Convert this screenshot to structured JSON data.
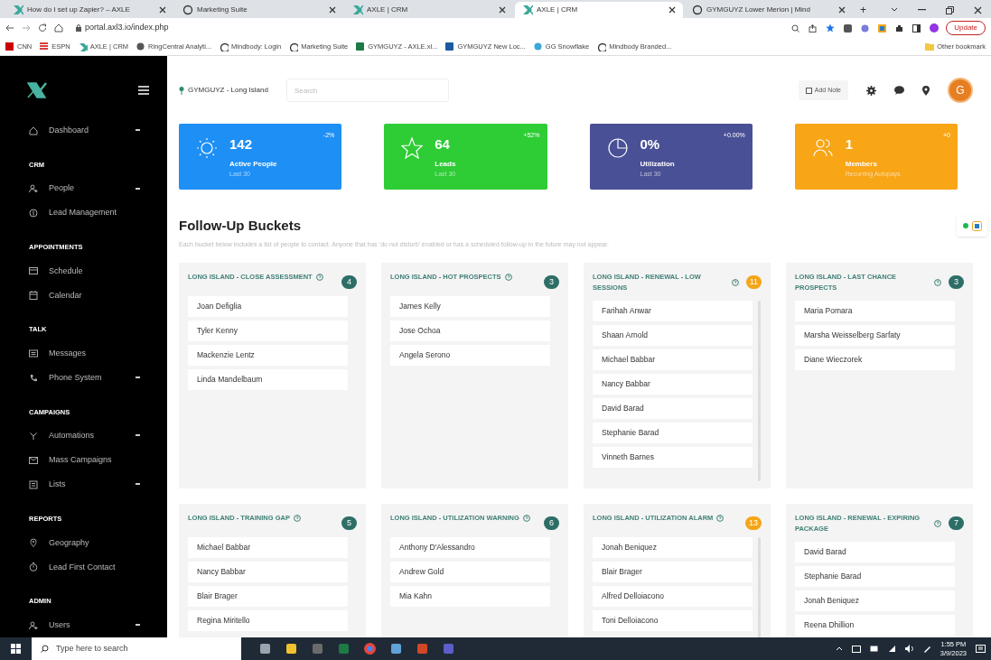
{
  "browser": {
    "tabs": [
      {
        "title": "How do I set up Zapier? – AXLE",
        "selected": false
      },
      {
        "title": "Marketing Suite",
        "selected": false
      },
      {
        "title": "AXLE | CRM",
        "selected": false
      },
      {
        "title": "AXLE | CRM",
        "selected": true
      },
      {
        "title": "GYMGUYZ Lower Merion | Mind",
        "selected": false
      }
    ],
    "new_tab": "+",
    "address": "portal.axl3.io/index.php",
    "update_button": "Update",
    "bookmarks": [
      "CNN",
      "ESPN",
      "AXLE | CRM",
      "RingCentral Analyti...",
      "Mindbody: Login",
      "Marketing Suite",
      "GYMGUYZ - AXLE.xl...",
      "GYMGUYZ New Loc...",
      "GG Snowflake",
      "Mindbody Branded..."
    ],
    "other_bookmarks": "Other bookmark"
  },
  "sidebar": {
    "sections": [
      {
        "items": [
          {
            "label": "Dashboard",
            "submenu": true
          }
        ]
      },
      {
        "heading": "CRM",
        "items": [
          {
            "label": "People",
            "submenu": true
          },
          {
            "label": "Lead Management",
            "submenu": false
          }
        ]
      },
      {
        "heading": "APPOINTMENTS",
        "items": [
          {
            "label": "Schedule",
            "submenu": false
          },
          {
            "label": "Calendar",
            "submenu": false
          }
        ]
      },
      {
        "heading": "TALK",
        "items": [
          {
            "label": "Messages",
            "submenu": false
          },
          {
            "label": "Phone System",
            "submenu": true
          }
        ]
      },
      {
        "heading": "CAMPAIGNS",
        "items": [
          {
            "label": "Automations",
            "submenu": true
          },
          {
            "label": "Mass Campaigns",
            "submenu": false
          },
          {
            "label": "Lists",
            "submenu": true
          }
        ]
      },
      {
        "heading": "REPORTS",
        "items": [
          {
            "label": "Geography",
            "submenu": false
          },
          {
            "label": "Lead First Contact",
            "submenu": false
          }
        ]
      },
      {
        "heading": "ADMIN",
        "items": [
          {
            "label": "Users",
            "submenu": true
          }
        ]
      }
    ]
  },
  "topbar": {
    "location": "GYMGUYZ - Long Island",
    "search_placeholder": "Search",
    "add_note": "Add Note",
    "avatar": "G"
  },
  "stats": [
    {
      "value": "142",
      "label": "Active People",
      "sub": "Last 30",
      "change": "-2%",
      "color": "#1e8ff5"
    },
    {
      "value": "64",
      "label": "Leads",
      "sub": "Last 30",
      "change": "+52%",
      "color": "#2ecc35"
    },
    {
      "value": "0%",
      "label": "Utilization",
      "sub": "Last 30",
      "change": "+0.00%",
      "color": "#4a5096"
    },
    {
      "value": "1",
      "label": "Members",
      "sub": "Recurring Autopays",
      "change": "+0",
      "color": "#f8a516"
    }
  ],
  "buckets_section": {
    "title": "Follow-Up Buckets",
    "description": "Each bucket below includes a list of people to contact. Anyone that has 'do not disturb' enabled or has a scheduled follow-up in the future may not appear."
  },
  "buckets": [
    {
      "title": "LONG ISLAND - CLOSE ASSESSMENT",
      "count": "4",
      "color": "#2d6e67",
      "scrollable": false,
      "people": [
        "Joan Defiglia",
        "Tyler Kenny",
        "Mackenzie Lentz",
        "Linda Mandelbaum"
      ]
    },
    {
      "title": "LONG ISLAND - HOT PROSPECTS",
      "count": "3",
      "color": "#2d6e67",
      "scrollable": false,
      "people": [
        "James Kelly",
        "Jose Ochoa",
        "Angela Serono"
      ]
    },
    {
      "title": "LONG ISLAND - RENEWAL - LOW SESSIONS",
      "count": "11",
      "color": "#f5a516",
      "scrollable": true,
      "people": [
        "Farihah Anwar",
        "Shaan Arnold",
        "Michael Babbar",
        "Nancy Babbar",
        "David Barad",
        "Stephanie Barad",
        "Vinneth Barnes"
      ]
    },
    {
      "title": "LONG ISLAND - LAST CHANCE PROSPECTS",
      "count": "3",
      "color": "#2d6e67",
      "scrollable": false,
      "people": [
        "Maria Pomara",
        "Marsha Weisselberg Sarfaty",
        "Diane Wieczorek"
      ]
    },
    {
      "title": "LONG ISLAND - TRAINING GAP",
      "count": "5",
      "color": "#2d6e67",
      "scrollable": false,
      "people": [
        "Michael Babbar",
        "Nancy Babbar",
        "Blair Brager",
        "Regina Miritello"
      ]
    },
    {
      "title": "LONG ISLAND - UTILIZATION WARNING",
      "count": "6",
      "color": "#2d6e67",
      "scrollable": false,
      "people": [
        "Anthony D'Alessandro",
        "Andrew Gold",
        "Mia Kahn"
      ]
    },
    {
      "title": "LONG ISLAND - UTILIZATION ALARM",
      "count": "13",
      "color": "#f5a516",
      "scrollable": true,
      "people": [
        "Jonah Beniquez",
        "Blair Brager",
        "Alfred Delloiacono",
        "Toni Delloiacono"
      ]
    },
    {
      "title": "LONG ISLAND - RENEWAL - EXPIRING PACKAGE",
      "count": "7",
      "color": "#2d6e67",
      "scrollable": false,
      "people": [
        "David Barad",
        "Stephanie Barad",
        "Jonah Beniquez",
        "Reena Dhillion"
      ]
    }
  ],
  "taskbar": {
    "search_placeholder": "Type here to search",
    "time": "1:55 PM",
    "date": "3/9/2023"
  }
}
